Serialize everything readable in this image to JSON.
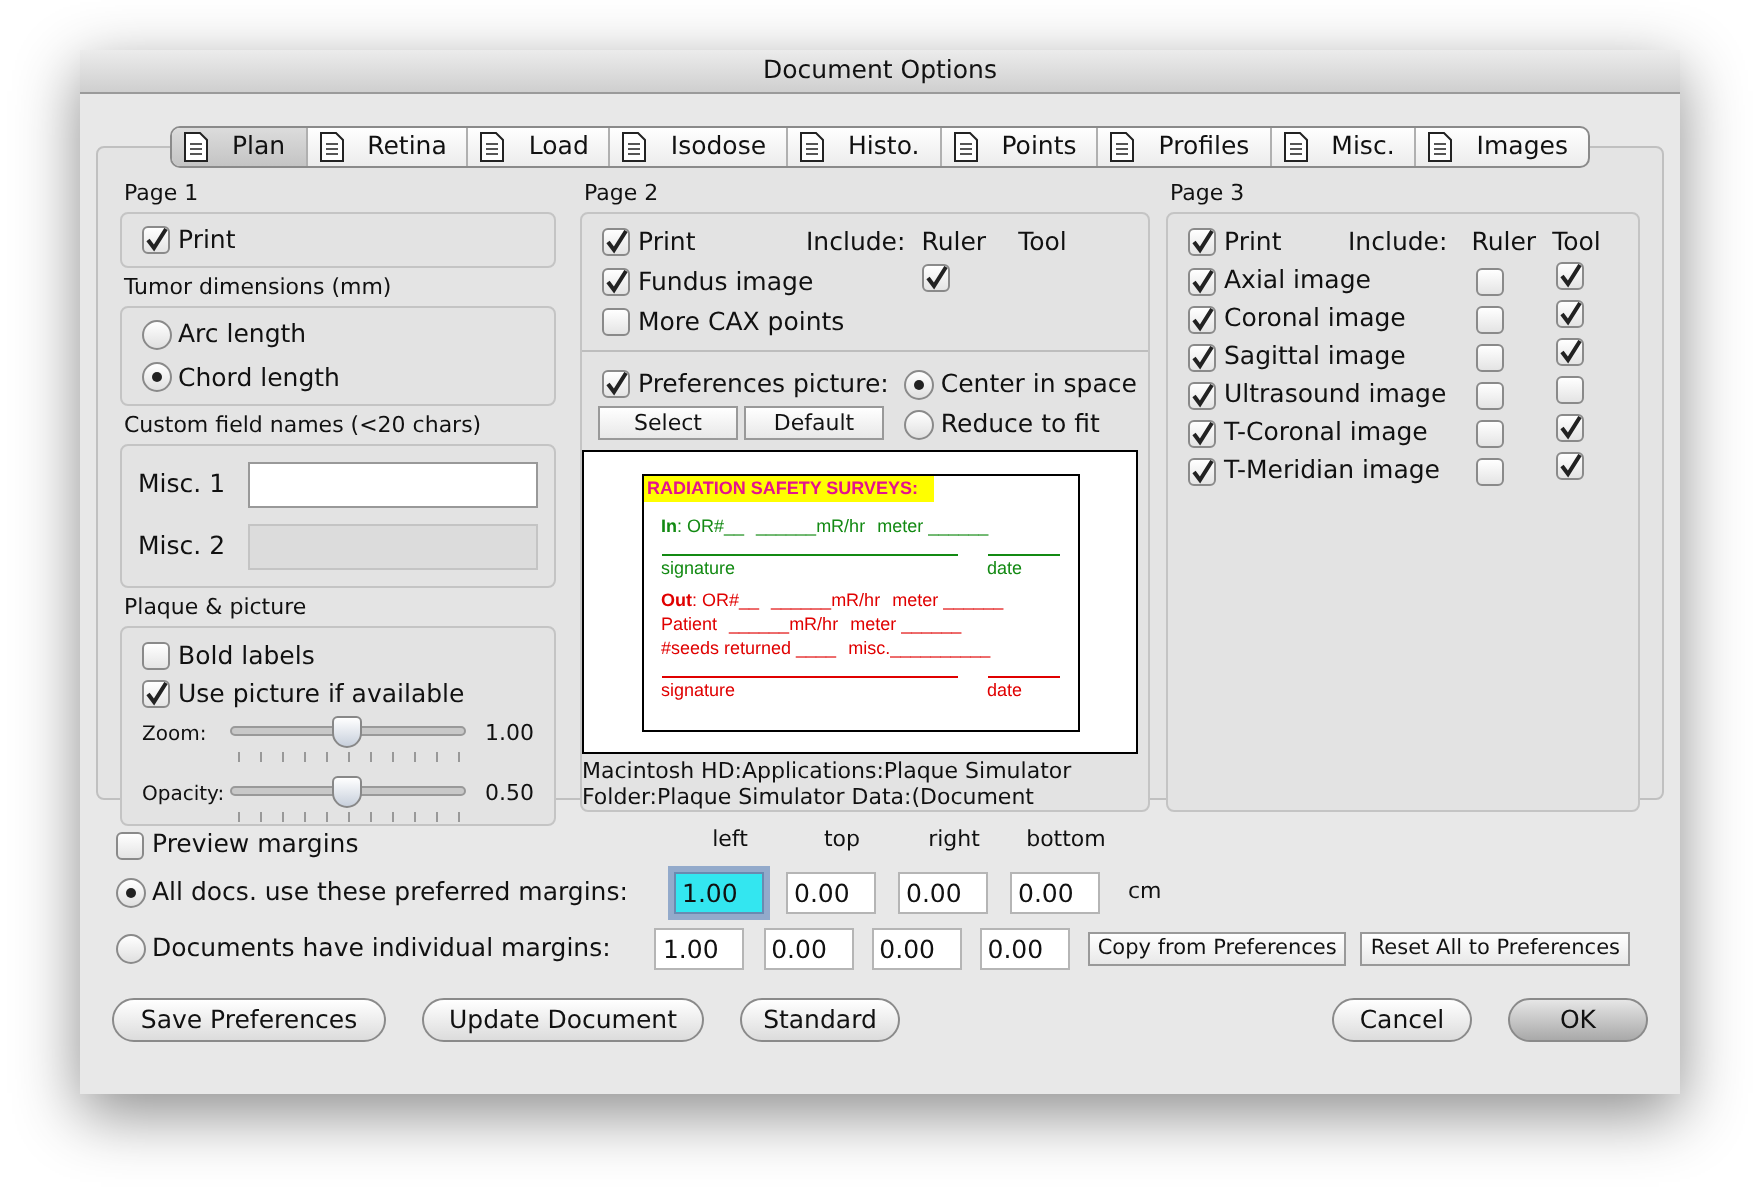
{
  "window": {
    "title": "Document Options"
  },
  "tabs": [
    {
      "label": "Plan",
      "selected": true
    },
    {
      "label": "Retina",
      "selected": false
    },
    {
      "label": "Load",
      "selected": false
    },
    {
      "label": "Isodose",
      "selected": false
    },
    {
      "label": "Histo.",
      "selected": false
    },
    {
      "label": "Points",
      "selected": false
    },
    {
      "label": "Profiles",
      "selected": false
    },
    {
      "label": "Misc.",
      "selected": false
    },
    {
      "label": "Images",
      "selected": false
    }
  ],
  "page1": {
    "title": "Page 1",
    "print": {
      "label": "Print",
      "checked": true
    },
    "tumor": {
      "title": "Tumor dimensions (mm)",
      "options": [
        {
          "label": "Arc length",
          "selected": false
        },
        {
          "label": "Chord length",
          "selected": true
        }
      ]
    },
    "custom_fields": {
      "title": "Custom field names (<20 chars)",
      "fields": [
        {
          "label": "Misc. 1",
          "disabled": false
        },
        {
          "label": "Misc. 2",
          "disabled": true
        }
      ]
    },
    "plaque": {
      "title": "Plaque & picture",
      "checkboxes": [
        {
          "label": "Bold labels",
          "checked": false
        },
        {
          "label": "Use picture if available",
          "checked": true
        }
      ],
      "sliders": [
        {
          "label": "Zoom:",
          "level": 0.5,
          "reading": "1.00"
        },
        {
          "label": "Opacity:",
          "level": 0.5,
          "reading": "0.50"
        }
      ]
    }
  },
  "page2": {
    "title": "Page 2",
    "include_label": "Include:",
    "ruler_label": "Ruler",
    "tool_label": "Tool",
    "rows": [
      {
        "label": "Print",
        "checked": true
      },
      {
        "label": "Fundus image",
        "checked": true,
        "ruler": true
      },
      {
        "label": "More CAX points",
        "checked": false
      }
    ],
    "preferences_picture": {
      "label": "Preferences picture:",
      "checked": true,
      "buttons": [
        "Select",
        "Default"
      ],
      "placement": [
        {
          "label": "Center in space",
          "selected": true
        },
        {
          "label": "Reduce to fit",
          "selected": false
        }
      ]
    },
    "preview": {
      "heading": "RADIATION SAFETY SURVEYS:",
      "sections": [
        {
          "color": "#138a13",
          "lines": [
            {
              "kind": "text",
              "parts": [
                "**In**:  OR#__",
                "______mR/hr",
                "meter ______"
              ]
            },
            {
              "kind": "signature",
              "parts": [
                "signature",
                "date"
              ]
            }
          ]
        },
        {
          "color": "#e00000",
          "lines": [
            {
              "kind": "text",
              "parts": [
                "**Out**: OR#__",
                "______mR/hr",
                "meter ______"
              ]
            },
            {
              "kind": "text",
              "parts": [
                "Patient",
                "______mR/hr",
                "meter ______"
              ]
            },
            {
              "kind": "text",
              "parts": [
                "#seeds returned ____",
                "misc.__________"
              ]
            },
            {
              "kind": "signature",
              "parts": [
                "signature",
                "date"
              ]
            }
          ]
        }
      ]
    },
    "path_lines": [
      "Macintosh HD:Applications:Plaque Simulator",
      "Folder:Plaque Simulator Data:(Document"
    ]
  },
  "page3": {
    "title": "Page 3",
    "print": {
      "label": "Print",
      "checked": true
    },
    "include_label": "Include:",
    "ruler_label": "Ruler",
    "tool_label": "Tool",
    "rows": [
      {
        "label": "Axial image",
        "checked": true,
        "ruler": false,
        "tool": true
      },
      {
        "label": "Coronal image",
        "checked": true,
        "ruler": false,
        "tool": true
      },
      {
        "label": "Sagittal image",
        "checked": true,
        "ruler": false,
        "tool": true
      },
      {
        "label": "Ultrasound image",
        "checked": true,
        "ruler": false,
        "tool": false
      },
      {
        "label": "T-Coronal image",
        "checked": true,
        "ruler": false,
        "tool": true
      },
      {
        "label": "T-Meridian image",
        "checked": true,
        "ruler": false,
        "tool": true
      }
    ]
  },
  "margins": {
    "preview": {
      "label": "Preview margins",
      "checked": false
    },
    "columns": [
      "left",
      "top",
      "right",
      "bottom"
    ],
    "unit": "cm",
    "rows": [
      {
        "label": "All docs. use these preferred margins:",
        "selected": true,
        "values": [
          {
            "value": "1.00",
            "focused": true
          },
          {
            "value": "0.00",
            "focused": false
          },
          {
            "value": "0.00",
            "focused": false
          },
          {
            "value": "0.00",
            "focused": false
          }
        ]
      },
      {
        "label": "Documents have individual margins:",
        "selected": false,
        "values": [
          {
            "value": "1.00",
            "focused": false
          },
          {
            "value": "0.00",
            "focused": false
          },
          {
            "value": "0.00",
            "focused": false
          },
          {
            "value": "0.00",
            "focused": false
          }
        ],
        "buttons": [
          "Copy from Preferences",
          "Reset All to Preferences"
        ]
      }
    ]
  },
  "footer": {
    "left_buttons": [
      "Save Preferences",
      "Update Document",
      "Standard"
    ],
    "right_buttons": [
      {
        "label": "Cancel",
        "default": false
      },
      {
        "label": "OK",
        "default": true
      }
    ]
  }
}
